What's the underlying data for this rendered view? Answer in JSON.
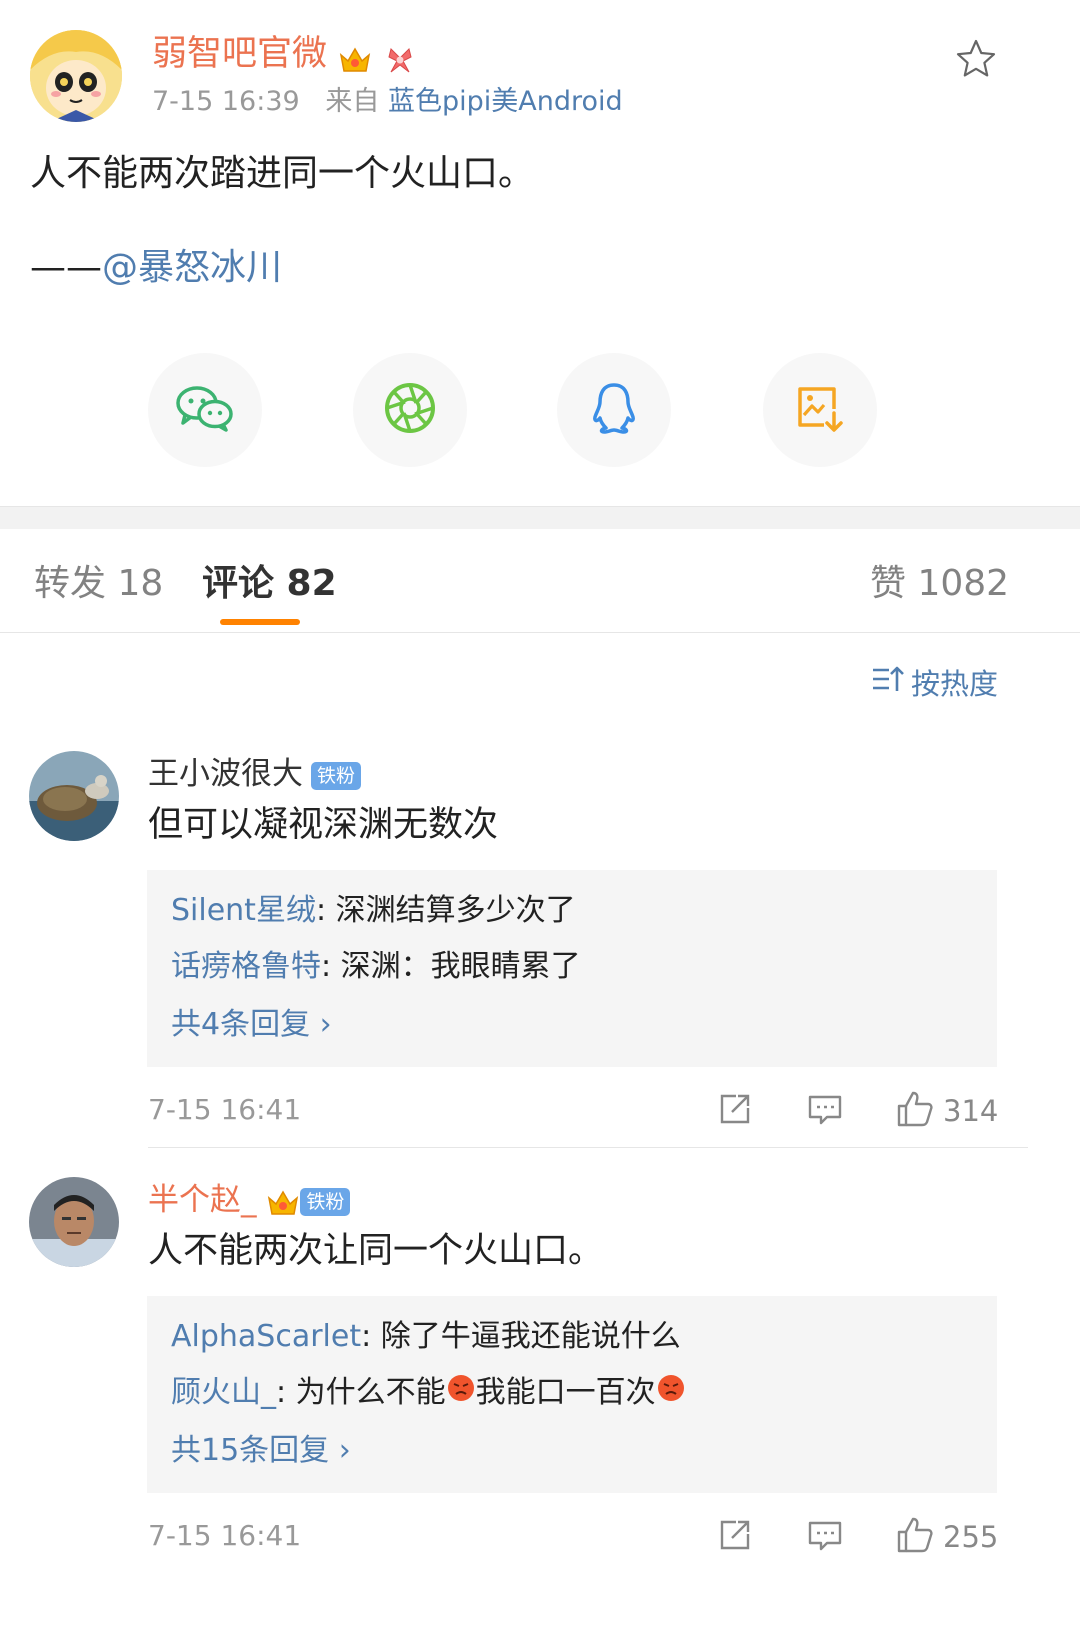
{
  "post": {
    "author": "弱智吧官微",
    "time": "7-15 16:39",
    "source_prefix": "来自",
    "source": "蓝色pipi美Android",
    "text": "人不能两次踏进同一个火山口。",
    "quote_dash": "——",
    "quote_mention": "@暴怒冰川"
  },
  "share": {
    "items": [
      "wechat-icon",
      "moments-icon",
      "qq-icon",
      "save-image-icon"
    ]
  },
  "tabs": {
    "repost": "转发 18",
    "comment": "评论 82",
    "like": "赞 1082"
  },
  "sort": {
    "label": "按热度"
  },
  "comments": [
    {
      "name": "王小波很大",
      "badge": "铁粉",
      "text": "但可以凝视深渊无数次",
      "replies": [
        {
          "user": "Silent星绒",
          "text": ": 深渊结算多少次了"
        },
        {
          "user": "话痨格鲁特",
          "text": ": 深渊：我眼睛累了"
        }
      ],
      "more": "共4条回复 ›",
      "time": "7-15 16:41",
      "likes": "314"
    },
    {
      "name": "半个赵_",
      "badge": "铁粉",
      "text": "人不能两次让同一个火山口。",
      "replies": [
        {
          "user": "AlphaScarlet",
          "text": ": 除了牛逼我还能说什么"
        },
        {
          "user": "顾火山_",
          "text_a": ": 为什么不能",
          "text_b": "我能口一百次"
        }
      ],
      "more": "共15条回复 ›",
      "time": "7-15 16:41",
      "likes": "255"
    }
  ],
  "colors": {
    "accent_orange": "#ff8200",
    "author_orange": "#eb7350",
    "link_blue": "#507daf",
    "badge_blue": "#6aa6e8"
  }
}
